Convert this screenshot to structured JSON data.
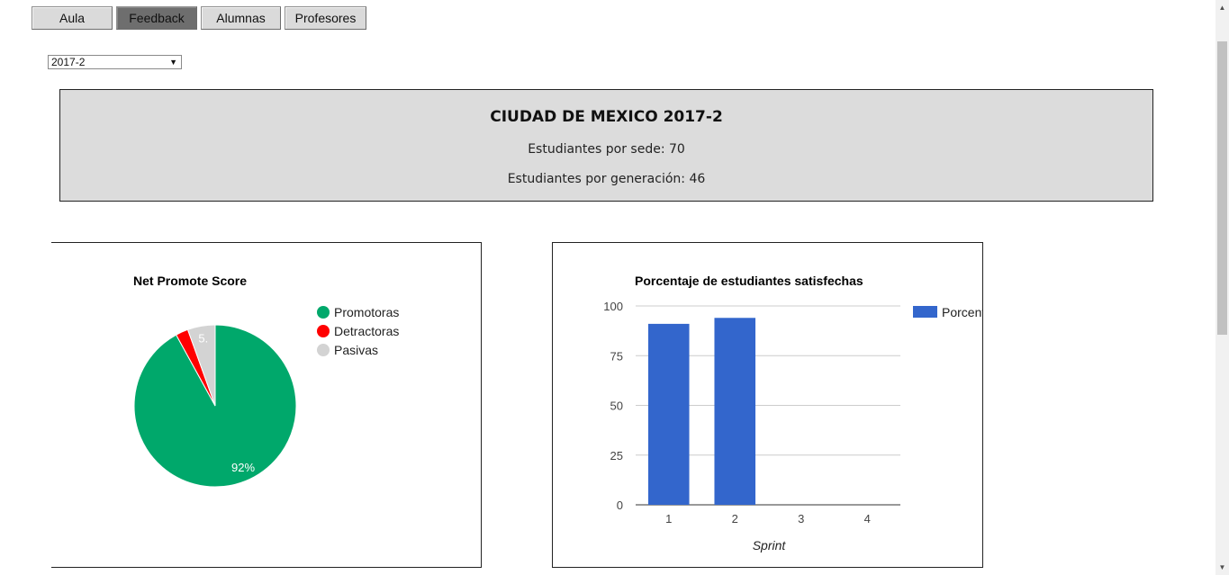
{
  "nav": {
    "tabs": [
      {
        "label": "Aula",
        "active": false
      },
      {
        "label": "Feedback",
        "active": true
      },
      {
        "label": "Alumnas",
        "active": false
      },
      {
        "label": "Profesores",
        "active": false
      }
    ]
  },
  "generation_select": {
    "value": "2017-2"
  },
  "summary": {
    "title": "CIUDAD DE MEXICO 2017-2",
    "by_campus": "Estudiantes por sede: 70",
    "by_generation": "Estudiantes por generación: 46"
  },
  "chart_data": [
    {
      "type": "pie",
      "title": "Net Promote Score",
      "labels": [
        "Promotoras",
        "Detractoras",
        "Pasivas"
      ],
      "values": [
        92,
        2.5,
        5.5
      ],
      "slice_labels": [
        "92%",
        "",
        "5."
      ],
      "colors": [
        "#00a86b",
        "#ff0000",
        "#d3d3d3"
      ],
      "legend": "right"
    },
    {
      "type": "bar",
      "title": "Porcentaje de estudiantes satisfechas",
      "categories": [
        "1",
        "2",
        "3",
        "4"
      ],
      "series": [
        {
          "name": "Porcent",
          "values": [
            91,
            94,
            0,
            0
          ]
        }
      ],
      "xlabel": "Sprint",
      "ylabel": "",
      "ylim": [
        0,
        100
      ],
      "yticks": [
        0,
        25,
        50,
        75,
        100
      ],
      "color": "#3366cc",
      "grid": true,
      "legend": "right"
    }
  ]
}
